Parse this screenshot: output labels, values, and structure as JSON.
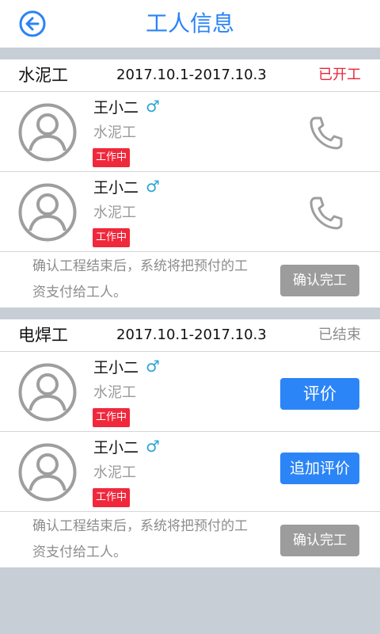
{
  "header": {
    "title": "工人信息",
    "back_icon": "back-arrow-icon"
  },
  "colors": {
    "accent": "#2b83f6",
    "badge_red": "#f0283c",
    "status_active": "#e8273a",
    "status_ended": "#8e8e8e",
    "button_gray": "#9c9c9c",
    "background": "#c8ced5"
  },
  "groups": [
    {
      "trade": "水泥工",
      "dates": "2017.10.1-2017.10.3",
      "status": "已开工",
      "workers": [
        {
          "name": "王小二",
          "gender": "♂",
          "role": "水泥工",
          "badge": "工作中",
          "action_icon": "phone-icon"
        },
        {
          "name": "王小二",
          "gender": "♂",
          "role": "水泥工",
          "badge": "工作中",
          "action_icon": "phone-icon"
        }
      ],
      "note": "确认工程结束后，系统将把预付的工资支付给工人。",
      "confirm_label": "确认完工"
    },
    {
      "trade": "电焊工",
      "dates": "2017.10.1-2017.10.3",
      "status": "已结束",
      "workers": [
        {
          "name": "王小二",
          "gender": "♂",
          "role": "水泥工",
          "badge": "工作中",
          "action_label": "评价"
        },
        {
          "name": "王小二",
          "gender": "♂",
          "role": "水泥工",
          "badge": "工作中",
          "action_label": "追加评价"
        }
      ],
      "note": "确认工程结束后，系统将把预付的工资支付给工人。",
      "confirm_label": "确认完工"
    }
  ]
}
